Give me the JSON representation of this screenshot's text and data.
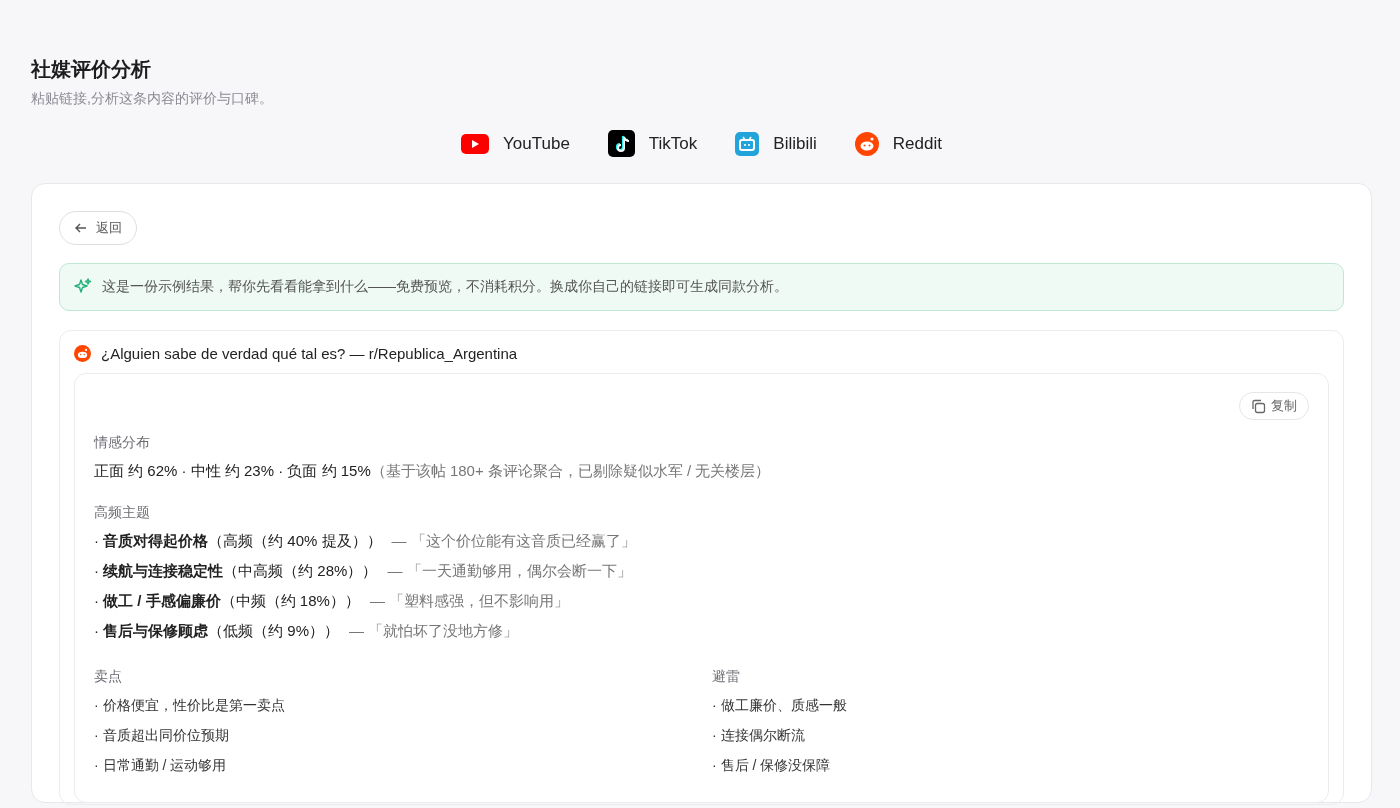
{
  "header": {
    "title": "社媒评价分析",
    "subtitle": "粘贴链接,分析这条内容的评价与口碑。"
  },
  "platforms": [
    {
      "kind": "youtube",
      "label": "YouTube"
    },
    {
      "kind": "tiktok",
      "label": "TikTok"
    },
    {
      "kind": "bilibili",
      "label": "Bilibili"
    },
    {
      "kind": "reddit",
      "label": "Reddit"
    }
  ],
  "back_button": "返回",
  "notice": "这是一份示例结果，帮你先看看能拿到什么——免费预览，不消耗积分。换成你自己的链接即可生成同款分析。",
  "post": {
    "kind": "reddit",
    "title": "¿Alguien sabe de verdad qué tal es? — r/Republica_Argentina",
    "copy_button": "复制",
    "sentiment": {
      "heading": "情感分布",
      "summary": "正面 约 62% · 中性 约 23% · 负面 约 15%",
      "note": "（基于该帖 180+ 条评论聚合，已剔除疑似水军 / 无关楼层）"
    },
    "themes": {
      "heading": "高频主题",
      "items": [
        {
          "text": "· **音质对得起价格**（高频（约 40% 提及））",
          "quote": "— 「这个价位能有这音质已经赢了」"
        },
        {
          "text": "· **续航与连接稳定性**（中高频（约 28%））",
          "quote": "— 「一天通勤够用，偶尔会断一下」"
        },
        {
          "text": "· **做工 / 手感偏廉价**（中频（约 18%））",
          "quote": "— 「塑料感强，但不影响用」"
        },
        {
          "text": "· **售后与保修顾虑**（低频（约 9%））",
          "quote": "— 「就怕坏了没地方修」"
        }
      ]
    },
    "pros": {
      "heading": "卖点",
      "items": [
        "· 价格便宜，性价比是第一卖点",
        "· 音质超出同价位预期",
        "· 日常通勤 / 运动够用"
      ]
    },
    "cons": {
      "heading": "避雷",
      "items": [
        "· 做工廉价、质感一般",
        "· 连接偶尔断流",
        "· 售后 / 保修没保障"
      ]
    }
  }
}
